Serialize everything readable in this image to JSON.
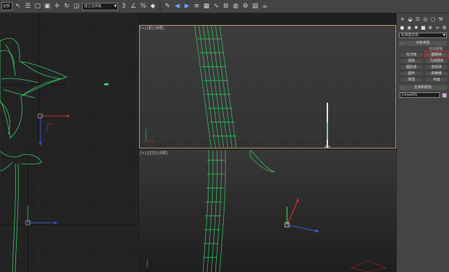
{
  "toolbar": {
    "selection_filter": "全部",
    "named_selection": "建立选择集",
    "colors": {
      "icon_blue": "#6aa8ff",
      "icon": "#d8d8d8"
    },
    "buttons": [
      "select-object-icon",
      "select-by-name-icon",
      "rectangular-selection-icon",
      "window-crossing-icon",
      "move-icon",
      "rotate-icon",
      "scale-icon",
      "reference-coordinate-icon",
      "snap-icon",
      "angle-snap-icon",
      "percent-snap-icon",
      "spinner-snap-icon",
      "edit-named-selection-icon",
      "mirror-icon",
      "align-icon",
      "layer-manager-icon",
      "graphite-tools-icon",
      "curve-editor-icon",
      "schematic-view-icon",
      "material-editor-icon",
      "render-setup-icon",
      "rendered-frame-icon",
      "render-icon"
    ]
  },
  "viewports": {
    "top_right_label": "[+] [前] [线框]",
    "bottom_right_label": "[+] [正交] [线框]",
    "model_color": "#3bd16b",
    "active_border_color": "#b8a060"
  },
  "command_panel": {
    "tab_icons": [
      "create-icon",
      "modify-icon",
      "hierarchy-icon",
      "motion-icon",
      "display-icon",
      "utilities-icon"
    ],
    "category_icons": [
      "geometry-icon",
      "shapes-icon",
      "lights-icon",
      "cameras-icon",
      "helpers-icon",
      "space-warps-icon",
      "systems-icon"
    ],
    "category_dropdown": "标准基本体",
    "object_type_title": "对象类型",
    "object_type_minus": "-",
    "autogrid": "自动栅格",
    "objects": [
      {
        "label": "长方体",
        "highlighted": false
      },
      {
        "label": "圆锥体",
        "highlighted": true
      },
      {
        "label": "球体",
        "highlighted": false
      },
      {
        "label": "几何球体",
        "highlighted": false
      },
      {
        "label": "圆柱体",
        "highlighted": false
      },
      {
        "label": "管状体",
        "highlighted": false
      },
      {
        "label": "圆环",
        "highlighted": false
      },
      {
        "label": "四棱锥",
        "highlighted": false
      },
      {
        "label": "茶壶",
        "highlighted": false
      },
      {
        "label": "平面",
        "highlighted": false
      }
    ],
    "name_color_title": "名称和颜色",
    "name_color_minus": "-",
    "object_name": "Cone001",
    "object_color": "#d8a0e0",
    "highlight_color": "#d42a2a"
  }
}
